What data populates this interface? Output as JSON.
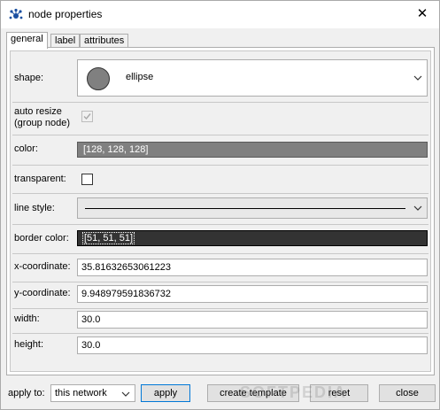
{
  "window": {
    "title": "node properties"
  },
  "tabs": [
    {
      "label": "general",
      "active": true
    },
    {
      "label": "label",
      "active": false
    },
    {
      "label": "attributes",
      "active": false
    }
  ],
  "general": {
    "shape": {
      "label": "shape:",
      "value": "ellipse",
      "swatch": "#808080"
    },
    "auto_resize": {
      "label_line1": "auto resize",
      "label_line2": "(group node)",
      "checked": true,
      "disabled": true
    },
    "color": {
      "label": "color:",
      "value": "[128, 128, 128]",
      "hex": "#808080"
    },
    "transparent": {
      "label": "transparent:",
      "checked": false
    },
    "line_style": {
      "label": "line style:",
      "value": "solid"
    },
    "border_color": {
      "label": "border color:",
      "value": "[51, 51, 51]",
      "hex": "#333333"
    },
    "x_coordinate": {
      "label": "x-coordinate:",
      "value": "35.81632653061223"
    },
    "y_coordinate": {
      "label": "y-coordinate:",
      "value": "9.948979591836732"
    },
    "width": {
      "label": "width:",
      "value": "30.0"
    },
    "height": {
      "label": "height:",
      "value": "30.0"
    }
  },
  "footer": {
    "apply_to_label": "apply to:",
    "apply_to_value": "this network",
    "apply_label": "apply",
    "create_template_label": "create template",
    "reset_label": "reset",
    "close_label": "close",
    "watermark": "SOFTPEDIA"
  }
}
